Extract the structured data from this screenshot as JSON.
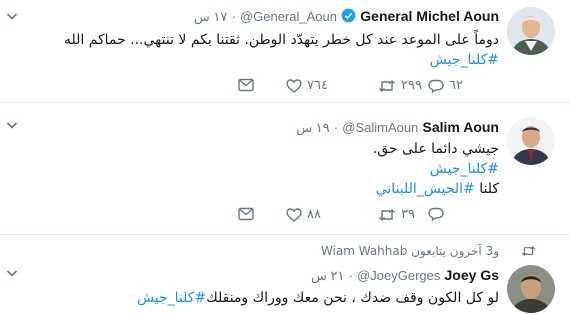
{
  "tweets": [
    {
      "name": "General Michel Aoun",
      "handle": "@General_Aoun",
      "time": "١٧ س",
      "line1": "دوماً على الموعد عند كل خطر يتهدّد الوطن. ثقتنا بكم لا تنتهي...   حماكم الله",
      "hashtag": "#كلنا_جيش",
      "replies": "٦٢",
      "retweets": "٢٩٩",
      "likes": "٧٦٤"
    },
    {
      "name": "Salim Aoun",
      "handle": "@SalimAoun",
      "time": "١٩ س",
      "line1": "جيشي دائما على حق.",
      "hashtag": "#كلنا_جيش",
      "line3_prefix": "كلنا",
      "line3_tag": "#الجيش_اللبناني",
      "replies": "",
      "retweets": "٣٩",
      "likes": "٨٨"
    },
    {
      "retweeted_by": "Wiam Wahhab و3 آخرون يتابعون",
      "name": "Joey Gs",
      "handle": "@JoeyGerges",
      "time": "٢١ س",
      "line1": "لو كل الكون وقف ضدك ، نحن معك ووراك ومنقلك",
      "hashtag": "#كلنا_جيش"
    }
  ],
  "colors": {
    "accent": "#1b95e0",
    "muted": "#657786",
    "border": "#e6ecf0"
  },
  "icons": [
    "caret-down-icon",
    "verified-badge-icon",
    "reply-icon",
    "retweet-icon",
    "like-icon",
    "message-icon"
  ]
}
